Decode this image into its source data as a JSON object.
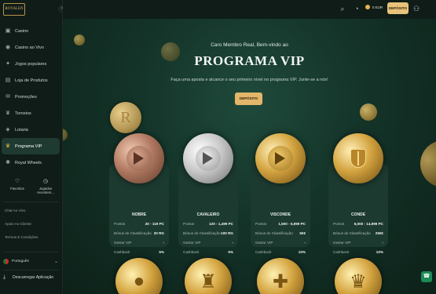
{
  "brand": {
    "logo_text": "ROYALEN"
  },
  "sidebar": {
    "items": [
      {
        "label": "Casino",
        "icon": "casino-icon",
        "glyph": "▣"
      },
      {
        "label": "Casino ao Vivo",
        "icon": "live-casino-icon",
        "glyph": "◉"
      },
      {
        "label": "Jogos populares",
        "icon": "popular-games-icon",
        "glyph": "✦"
      },
      {
        "label": "Loja de Produtos",
        "icon": "shop-icon",
        "glyph": "▤"
      },
      {
        "label": "Promoções",
        "icon": "promotions-icon",
        "glyph": "✉"
      },
      {
        "label": "Torneios",
        "icon": "trophy-icon",
        "glyph": "♛"
      },
      {
        "label": "Lotaria",
        "icon": "lottery-icon",
        "glyph": "◈"
      },
      {
        "label": "Programa VIP",
        "icon": "crown-icon",
        "glyph": "♛",
        "active": true
      },
      {
        "label": "Royal Wheels",
        "icon": "wheel-icon",
        "glyph": "✺"
      }
    ],
    "quick": [
      {
        "label": "Favoritos",
        "icon": "heart-icon",
        "glyph": "♡"
      },
      {
        "label": "Jogados recentem...",
        "icon": "clock-icon",
        "glyph": "◷"
      }
    ],
    "links": [
      "Chat Ao Vivo",
      "Apoio Ao Cliente",
      "Termos E Condições"
    ],
    "language": "Português",
    "download": "Descarregar Aplicação"
  },
  "header": {
    "balance": "0 EUR",
    "deposit_label": "DEPÓSITO"
  },
  "hero": {
    "welcome": "Caro Membro Real, Bem-vindo ao",
    "title": "PROGRAMA VIP",
    "subtitle": "Faça uma aposta e alcance o seu primeiro nível no programa VIP. Junte-se a nós!",
    "deposit_label": "DEPÓSITO"
  },
  "tiers": [
    {
      "name": "NOBRE",
      "medal": "bronze",
      "rows": [
        {
          "label": "Pontos",
          "value": "20 - 119 PC"
        },
        {
          "label": "Bónus de Classificação",
          "value": "20 RG"
        },
        {
          "label": "Gestor VIP",
          "value": "-"
        },
        {
          "label": "Cashback",
          "value": "5%"
        }
      ]
    },
    {
      "name": "CAVALEIRO",
      "medal": "silver",
      "rows": [
        {
          "label": "Pontos",
          "value": "120 - 1,499 PC"
        },
        {
          "label": "Bónus de Classificação",
          "value": "100 RG"
        },
        {
          "label": "Gestor VIP",
          "value": "-"
        },
        {
          "label": "Cashback",
          "value": "5%"
        }
      ]
    },
    {
      "name": "VISCONDE",
      "medal": "gold",
      "rows": [
        {
          "label": "Pontos",
          "value": "1,500 - 5,999 PC"
        },
        {
          "label": "Bónus de Classificação",
          "value": "50€"
        },
        {
          "label": "Gestor VIP",
          "value": "-"
        },
        {
          "label": "Cashback",
          "value": "10%"
        }
      ]
    },
    {
      "name": "CONDE",
      "medal": "gold-shield",
      "rows": [
        {
          "label": "Pontos",
          "value": "6,000 - 14,999 PC"
        },
        {
          "label": "Bónus de Classificação",
          "value": "250€"
        },
        {
          "label": "Gestor VIP",
          "value": "-"
        },
        {
          "label": "Cashback",
          "value": "10%"
        }
      ]
    }
  ],
  "lower_medals": [
    {
      "icon": "gold-medal-icon",
      "glyph": "●"
    },
    {
      "icon": "knight-helmet-medal-icon",
      "glyph": "♜"
    },
    {
      "icon": "cross-medal-icon",
      "glyph": "✚"
    },
    {
      "icon": "crown-medal-icon",
      "glyph": "♛"
    }
  ],
  "colors": {
    "accent": "#e3b66a",
    "background": "#0c1a15",
    "card": "#1c3a30",
    "sidebar_active": "#1f3a30"
  }
}
